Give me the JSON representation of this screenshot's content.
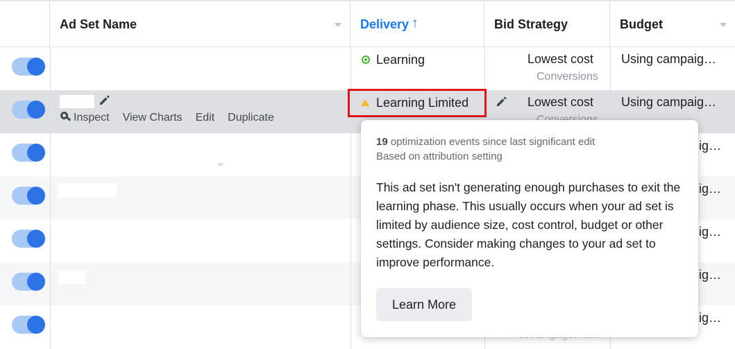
{
  "columns": {
    "name": "Ad Set Name",
    "delivery": "Delivery",
    "delivery_sort_icon": "arrow-up-icon",
    "bid_strategy": "Bid Strategy",
    "budget": "Budget"
  },
  "rows": [
    {
      "toggle": "on",
      "delivery": "Learning",
      "delivery_status_color": "#42b72a",
      "bid": "Lowest cost",
      "bid_sub": "Conversions",
      "budget": "Using campaig…"
    },
    {
      "toggle": "on",
      "delivery": "Learning Limited",
      "delivery_status_color": "#f7b928",
      "bid": "Lowest cost",
      "bid_sub": "Conversions",
      "budget": "Using campaig…"
    },
    {
      "toggle": "on",
      "budget_fragment": "ig…"
    },
    {
      "toggle": "on",
      "budget_fragment": "ig…"
    },
    {
      "toggle": "on",
      "budget_fragment": "ig…"
    },
    {
      "toggle": "on",
      "budget_fragment": "ig…"
    },
    {
      "toggle": "on",
      "budget_fragment": "ig…",
      "bid_sub": "Post Engagement"
    }
  ],
  "row_actions": {
    "inspect": "Inspect",
    "view_charts": "View Charts",
    "edit": "Edit",
    "duplicate": "Duplicate"
  },
  "tooltip": {
    "events_count": "19",
    "events_text": " optimization events since last significant edit",
    "attribution": "Based on attribution setting",
    "body": "This ad set isn't generating enough purchases to exit the learning phase. This usually occurs when your ad set is limited by audience size, cost control, budget or other settings. Consider making changes to your ad set to improve performance.",
    "button": "Learn More"
  },
  "colors": {
    "accent": "#1877f2",
    "toggle_on": "#2d73e6",
    "learning": "#42b72a",
    "learning_limited": "#f7b928",
    "highlight": "#e0161c"
  }
}
